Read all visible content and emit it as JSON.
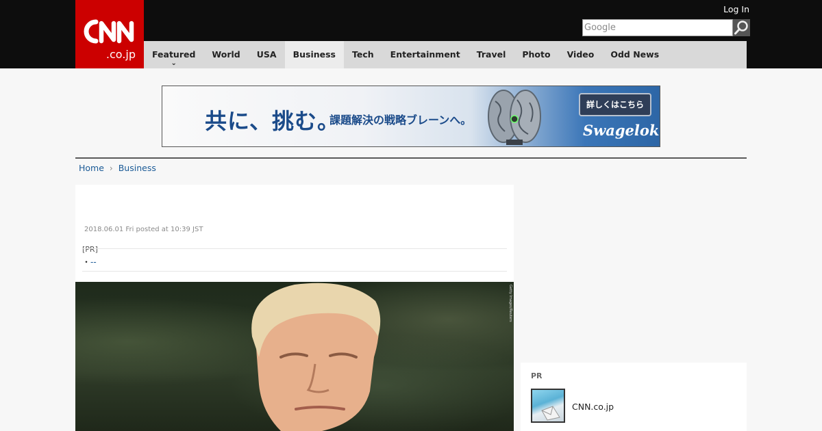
{
  "header": {
    "logo_main": "CNN",
    "logo_sub": ".co.jp",
    "login": "Log In",
    "search_placeholder": "Google"
  },
  "nav": {
    "items": [
      {
        "label": "Featured"
      },
      {
        "label": "World"
      },
      {
        "label": "USA"
      },
      {
        "label": "Business"
      },
      {
        "label": "Tech"
      },
      {
        "label": "Entertainment"
      },
      {
        "label": "Travel"
      },
      {
        "label": "Photo"
      },
      {
        "label": "Video"
      },
      {
        "label": "Odd News"
      }
    ],
    "active": "Business"
  },
  "ad": {
    "headline": "共に、挑む。",
    "subline": "課題解決の戦略ブレーンへ。",
    "button": "詳しくはこちら",
    "brand": "Swagelok"
  },
  "breadcrumb": {
    "home": "Home",
    "section": "Business"
  },
  "article": {
    "dateline": "2018.06.01 Fri posted at 10:39 JST",
    "pr_label": "[PR]",
    "pr_link": "--",
    "photo_credit": "Getty Images/Reuters"
  },
  "sidebar": {
    "pr_label": "PR",
    "item_text": "CNN.co.jp"
  },
  "colors": {
    "brand_red": "#cc0000",
    "link": "#1a5a96"
  }
}
